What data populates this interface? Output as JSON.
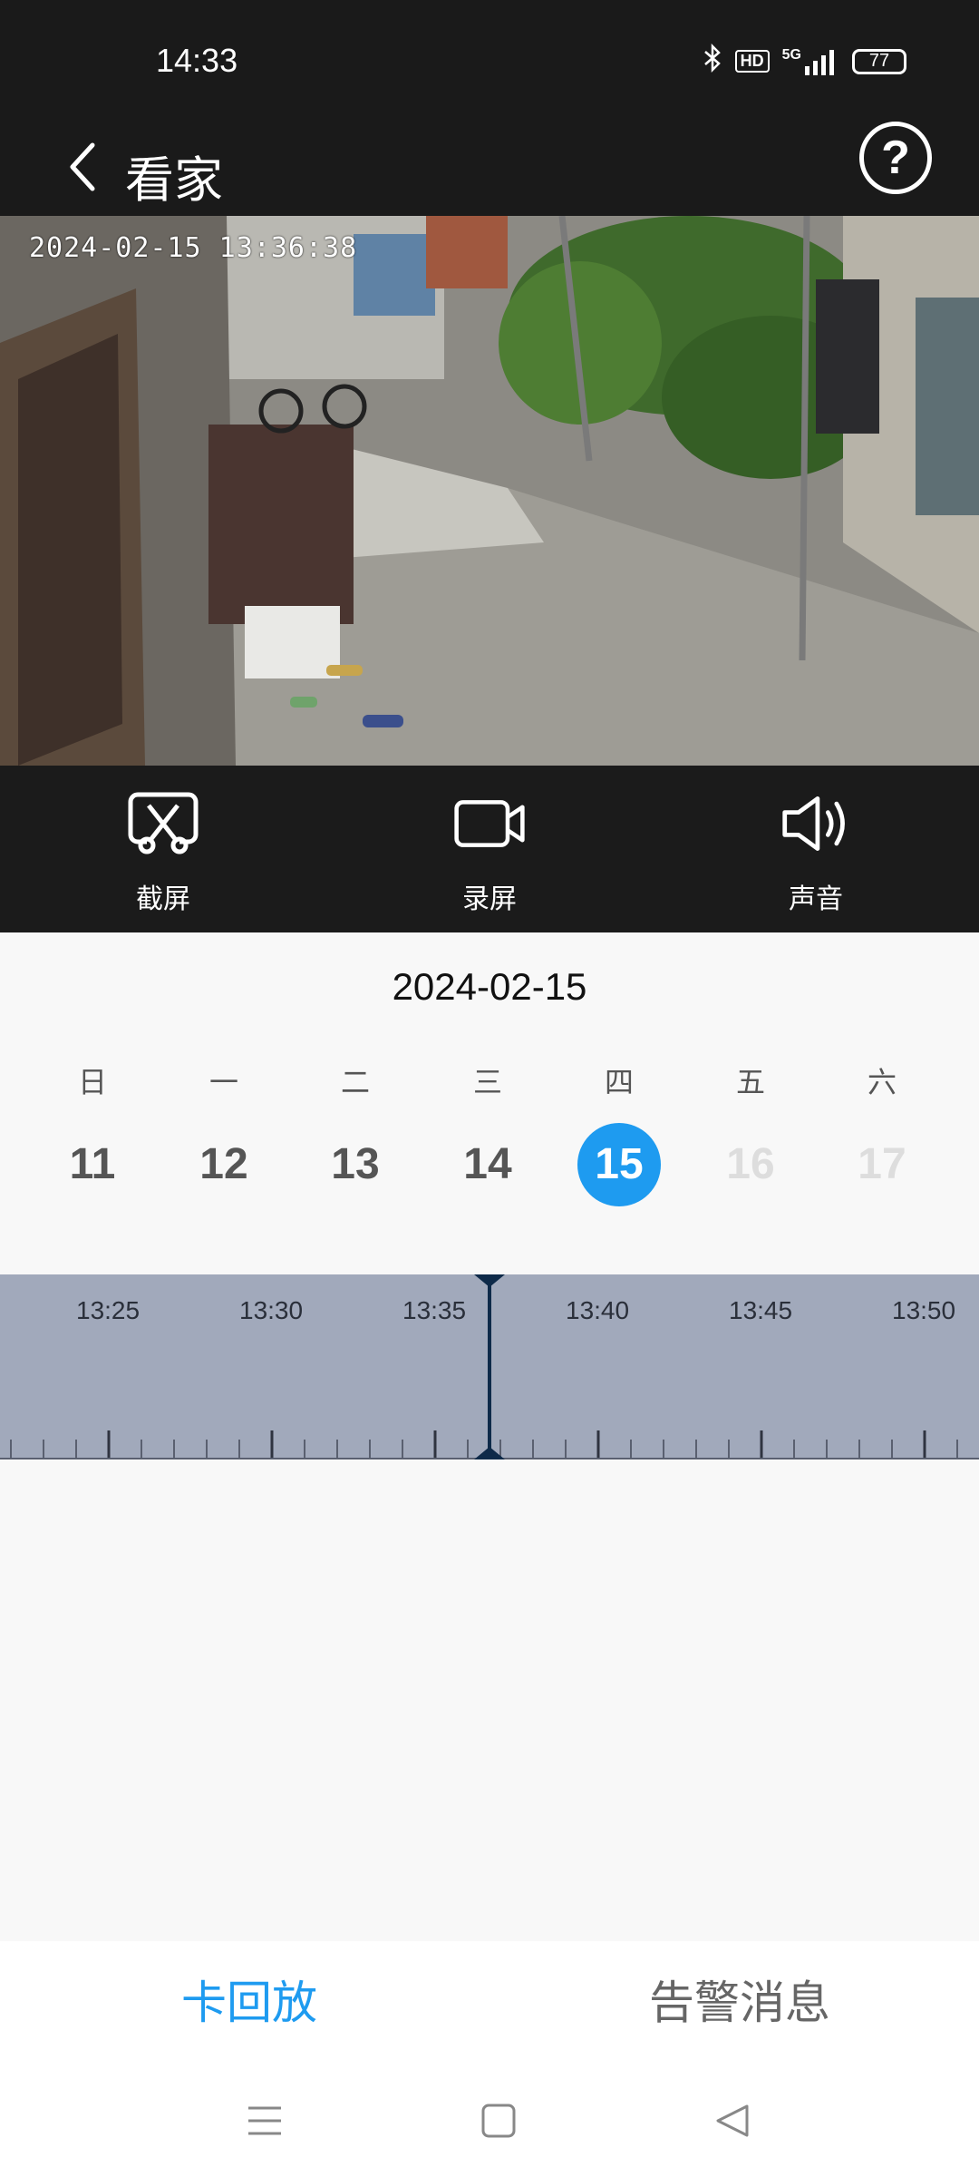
{
  "status_bar": {
    "time": "14:33",
    "icons": [
      "bluetooth-icon",
      "hd-icon",
      "5g-signal-icon",
      "signal-bars-icon"
    ],
    "hd": "HD",
    "network": "5G",
    "battery": "77"
  },
  "header": {
    "title": "看家",
    "help": "?"
  },
  "video": {
    "timestamp": "2024-02-15 13:36:38"
  },
  "controls": [
    {
      "label": "截屏",
      "icon": "screenshot-scissors-icon"
    },
    {
      "label": "录屏",
      "icon": "video-camera-icon"
    },
    {
      "label": "声音",
      "icon": "speaker-icon"
    }
  ],
  "calendar": {
    "date": "2024-02-15",
    "weekdays": [
      "日",
      "一",
      "二",
      "三",
      "四",
      "五",
      "六"
    ],
    "days": [
      "11",
      "12",
      "13",
      "14",
      "15",
      "16",
      "17"
    ],
    "selected_day": "15",
    "disabled_days": [
      "16",
      "17"
    ]
  },
  "timeline": {
    "labels": [
      "13:25",
      "13:30",
      "13:35",
      "13:40",
      "13:45",
      "13:50"
    ],
    "cursor_time": "13:36:38"
  },
  "tabs": {
    "left": "卡回放",
    "right": "告警消息",
    "active_color": "#1e9bf0",
    "inactive_color": "#666666"
  },
  "nav": [
    "menu-icon",
    "home-icon",
    "back-icon"
  ]
}
